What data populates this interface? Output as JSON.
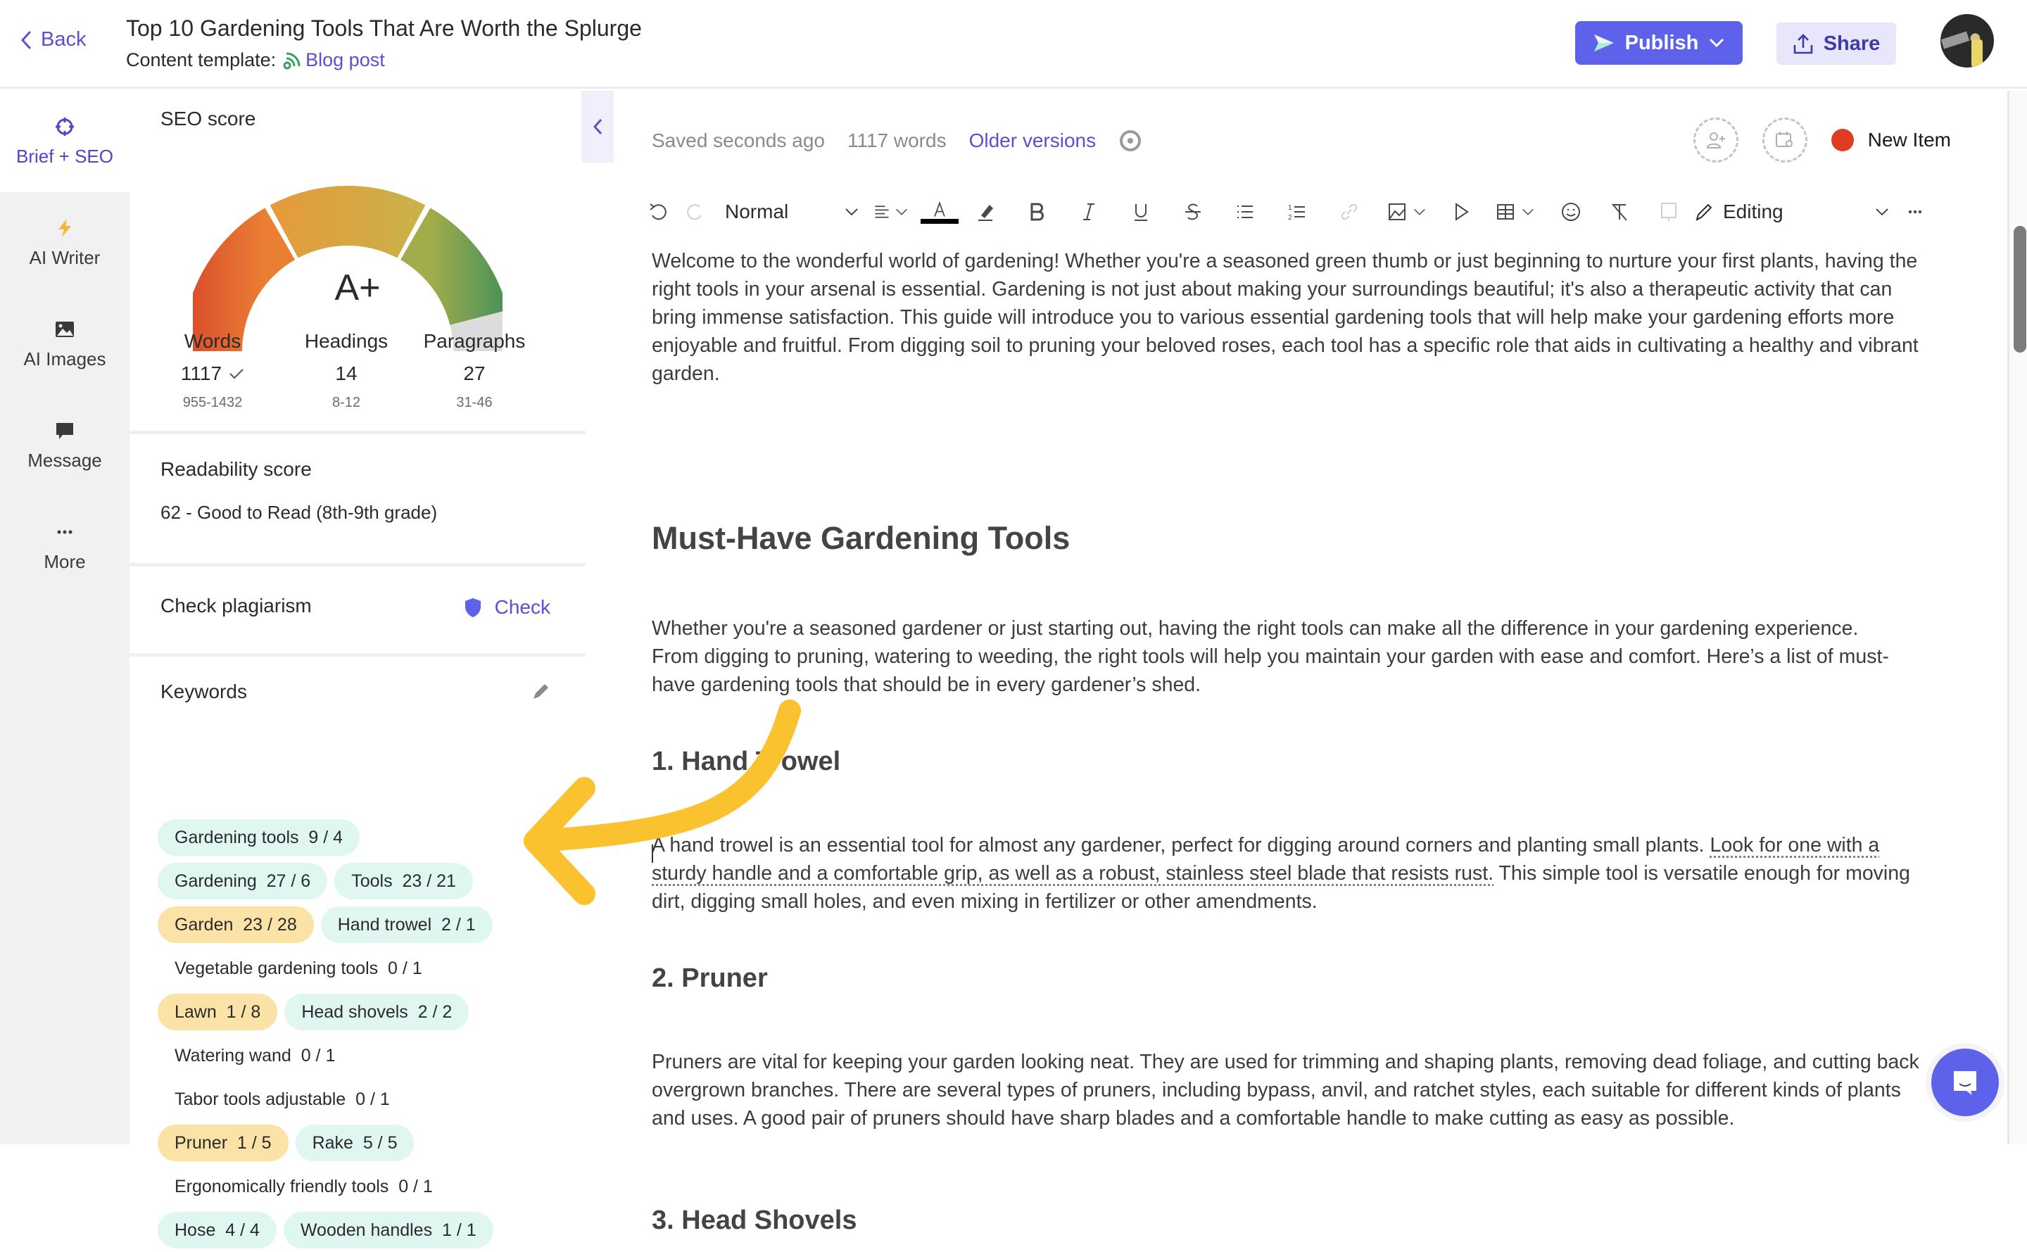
{
  "header": {
    "back_label": "Back",
    "title": "Top 10 Gardening Tools That Are Worth the Splurge",
    "template_label": "Content template:",
    "template_name": "Blog post",
    "publish_label": "Publish",
    "share_label": "Share"
  },
  "rail": {
    "items": [
      {
        "label": "Brief + SEO",
        "icon": "target-icon",
        "active": true
      },
      {
        "label": "AI Writer",
        "icon": "lightning-icon",
        "active": false
      },
      {
        "label": "AI Images",
        "icon": "image-icon",
        "active": false
      },
      {
        "label": "Message",
        "icon": "chat-bubble-icon",
        "active": false
      },
      {
        "label": "More",
        "icon": "more-dots-icon",
        "active": false
      }
    ]
  },
  "seo": {
    "title": "SEO score",
    "grade": "A+",
    "gauge_fill_fraction": 0.92,
    "stats": [
      {
        "label": "Words",
        "value": "1117",
        "range": "955-1432",
        "ok": true
      },
      {
        "label": "Headings",
        "value": "14",
        "range": "8-12",
        "ok": false
      },
      {
        "label": "Paragraphs",
        "value": "27",
        "range": "31-46",
        "ok": false
      }
    ]
  },
  "readability": {
    "title": "Readability score",
    "value": "62 - Good to Read (8th-9th grade)"
  },
  "plagiarism": {
    "title": "Check plagiarism",
    "action_label": "Check"
  },
  "keywords": {
    "title": "Keywords",
    "rows": [
      [
        {
          "term": "Gardening tools",
          "count": "9 / 4",
          "status": "ok"
        }
      ],
      [
        {
          "term": "Gardening",
          "count": "27 / 6",
          "status": "ok"
        },
        {
          "term": "Tools",
          "count": "23 / 21",
          "status": "ok"
        }
      ],
      [
        {
          "term": "Garden",
          "count": "23 / 28",
          "status": "warn"
        },
        {
          "term": "Hand trowel",
          "count": "2 / 1",
          "status": "ok"
        }
      ],
      [
        {
          "term": "Vegetable gardening tools",
          "count": "0 / 1",
          "status": "none"
        }
      ],
      [
        {
          "term": "Lawn",
          "count": "1 / 8",
          "status": "warn"
        },
        {
          "term": "Head shovels",
          "count": "2 / 2",
          "status": "ok"
        }
      ],
      [
        {
          "term": "Watering wand",
          "count": "0 / 1",
          "status": "none"
        }
      ],
      [
        {
          "term": "Tabor tools adjustable",
          "count": "0 / 1",
          "status": "none"
        }
      ],
      [
        {
          "term": "Pruner",
          "count": "1 / 5",
          "status": "warn"
        },
        {
          "term": "Rake",
          "count": "5 / 5",
          "status": "ok"
        }
      ],
      [
        {
          "term": "Ergonomically friendly tools",
          "count": "0 / 1",
          "status": "none"
        }
      ],
      [
        {
          "term": "Hose",
          "count": "4 / 4",
          "status": "ok"
        },
        {
          "term": "Wooden handles",
          "count": "1 / 1",
          "status": "ok"
        }
      ]
    ]
  },
  "editor": {
    "saved_status": "Saved seconds ago",
    "word_count": "1117 words",
    "older_versions_label": "Older versions",
    "item_status": "New Item",
    "item_status_color": "#e03c22",
    "toolbar": {
      "text_style": "Normal",
      "mode": "Editing"
    },
    "content": {
      "intro": "Welcome to the wonderful world of gardening! Whether you're a seasoned green thumb or just beginning to nurture your first plants, having the right tools in your arsenal is essential. Gardening is not just about making your surroundings beautiful; it's also a therapeutic activity that can bring immense satisfaction. This guide will introduce you to various essential gardening tools that will help make your gardening efforts more enjoyable and fruitful. From digging soil to pruning your beloved roses, each tool has a specific role that aids in cultivating a healthy and vibrant garden.",
      "h2": "Must-Have Gardening Tools",
      "p2": "Whether you're a seasoned gardener or just starting out, having the right tools can make all the difference in your gardening experience. From digging to pruning, watering to weeding, the right tools will help you maintain your garden with ease and comfort. Here’s a list of must-have gardening tools that should be in every gardener’s shed.",
      "h3_1": "1. Hand Trowel",
      "p3_a": "A hand trowel is an essential tool for almost any gardener, perfect for digging around corners and planting small plants. ",
      "p3_b": "Look for one with a sturdy handle and a comfortable grip, as well as a robust, stainless steel blade that resists rust.",
      "p3_c": " This simple tool is versatile enough for moving dirt, digging small holes, and even mixing in fertilizer or other amendments.",
      "h3_2": "2. Pruner",
      "p4": "Pruners are vital for keeping your garden looking neat. They are used for trimming and shaping plants, removing dead foliage, and cutting back overgrown branches. There are several types of pruners, including bypass, anvil, and ratchet styles, each suitable for different kinds of plants and uses. A good pair of pruners should have sharp blades and a comfortable handle to make cutting as easy as possible.",
      "h3_3": "3. Head Shovels"
    }
  },
  "colors": {
    "accent": "#5e62ea",
    "link": "#5a4fcf",
    "keyword_ok": "#dff7f0",
    "keyword_warn": "#fbe3a8",
    "annotation_arrow": "#f9c22e"
  }
}
